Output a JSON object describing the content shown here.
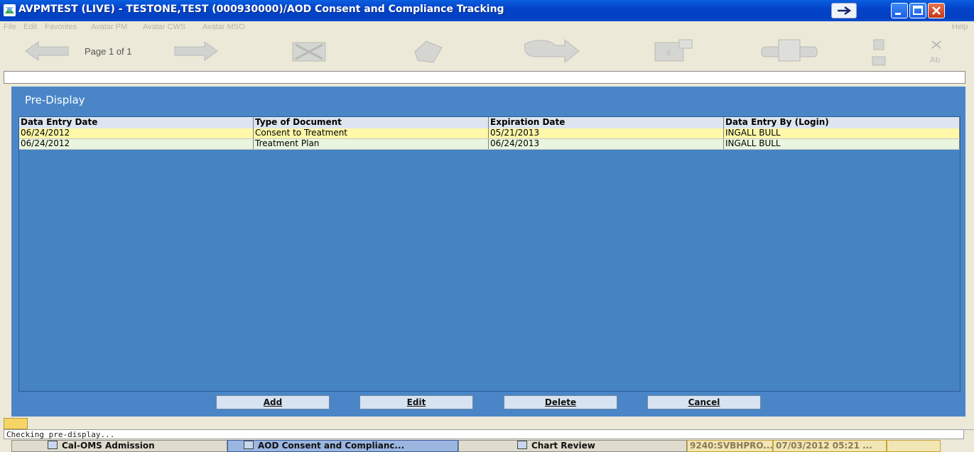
{
  "window": {
    "title": "AVPMTEST (LIVE) - TESTONE,TEST (000930000)/AOD Consent and Compliance Tracking"
  },
  "menu": {
    "items": [
      "File",
      "Edit",
      "Favorites",
      "Avatar PM",
      "Avatar CWS",
      "Avatar MSO"
    ],
    "help": "Help"
  },
  "toolbar": {
    "page_label": "Page 1 of 1",
    "icons": [
      "back-arrow-icon",
      "forward-arrow-icon",
      "close-form-icon",
      "erase-icon",
      "submit-icon",
      "dictionary-icon",
      "print-icon",
      "clipboard-icon",
      "spell-check-icon"
    ]
  },
  "form": {
    "section_title": "Pre-Display",
    "table": {
      "columns": [
        "Data Entry Date",
        "Type of Document",
        "Expiration Date",
        "Data Entry By (Login)"
      ],
      "rows": [
        [
          "06/24/2012",
          "Consent to Treatment",
          "05/21/2013",
          "INGALL BULL"
        ],
        [
          "06/24/2012",
          "Treatment Plan",
          "06/24/2013",
          "INGALL BULL"
        ]
      ]
    },
    "buttons": {
      "add": "Add",
      "edit": "Edit",
      "delete": "Delete",
      "cancel": "Cancel"
    }
  },
  "status": {
    "text": "Checking pre-display..."
  },
  "taskbar": {
    "tasks": [
      "Cal-OMS Admission",
      "AOD Consent and Complianc...",
      "Chart Review"
    ],
    "active_index": 1,
    "server": "9240:SVBHPRO...",
    "datetime": "07/03/2012 05:21 ..."
  },
  "colors": {
    "title_bar": "#0343c9",
    "panel": "#4a86c7",
    "selected_row": "#fff8a8",
    "alt_row": "#e9f5de"
  }
}
